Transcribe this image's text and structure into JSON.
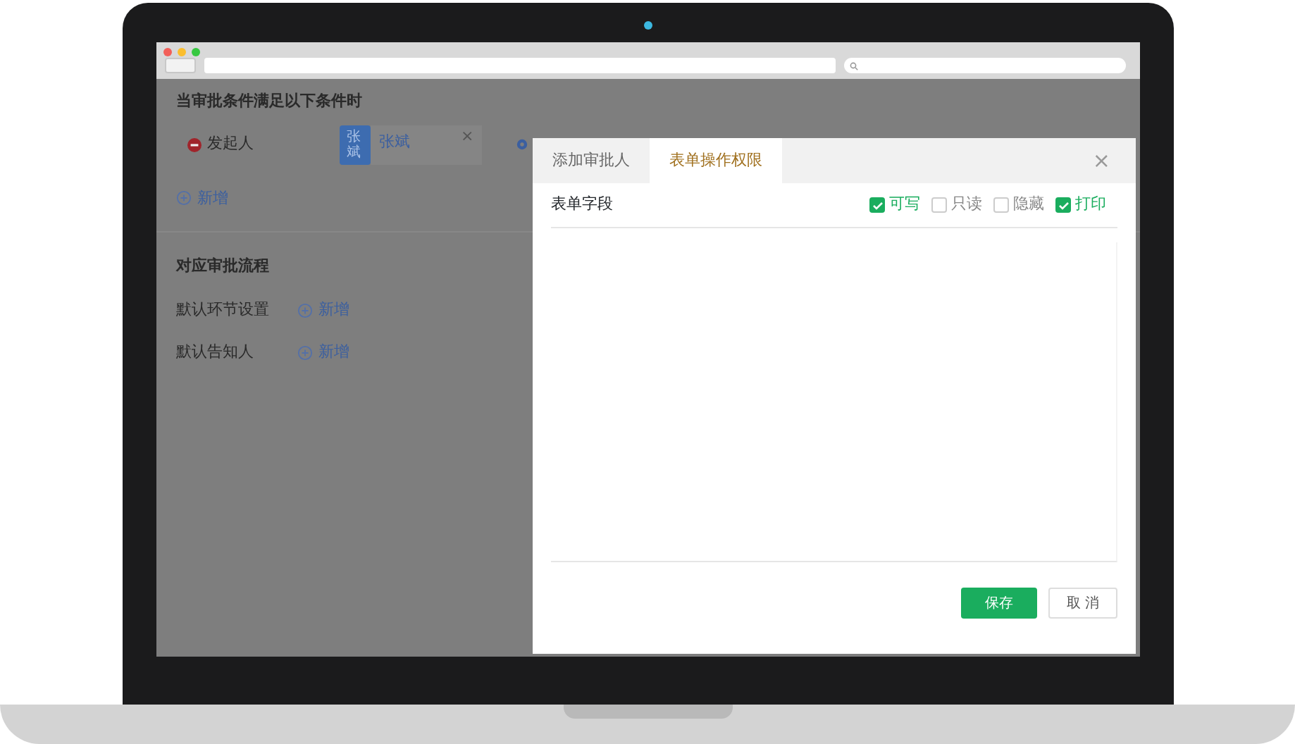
{
  "condition_section": {
    "title": "当审批条件满足以下条件时",
    "initiator": {
      "label": "发起人"
    },
    "approver_tag": {
      "avatar": "张斌",
      "name": "张斌",
      "close": "×"
    },
    "add_link": "新增"
  },
  "flow_section": {
    "title": "对应审批流程",
    "rows": [
      {
        "label": "默认环节设置",
        "add_link": "新增"
      },
      {
        "label": "默认告知人",
        "add_link": "新增"
      }
    ]
  },
  "dialog": {
    "tabs": [
      {
        "label": "添加审批人",
        "selected": false
      },
      {
        "label": "表单操作权限",
        "selected": true
      }
    ],
    "close": "×",
    "field_header": "表单字段",
    "permissions": [
      {
        "label": "可写",
        "checked": true
      },
      {
        "label": "只读",
        "checked": false
      },
      {
        "label": "隐藏",
        "checked": false
      },
      {
        "label": "打印",
        "checked": true
      }
    ],
    "buttons": [
      {
        "label": "保存",
        "kind": "primary"
      },
      {
        "label": "取 消",
        "kind": "secondary"
      }
    ]
  }
}
